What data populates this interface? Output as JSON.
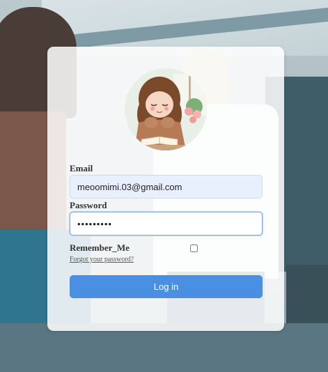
{
  "form": {
    "email_label": "Email",
    "email_value": "meoomimi.03@gmail.com",
    "password_label": "Password",
    "password_value": "•••••••••",
    "remember_label": "Remember_Me",
    "remember_checked": false,
    "forgot_link": "Forgot your password?",
    "login_button": "Log in"
  },
  "colors": {
    "button": "#4a90e2",
    "email_fill": "#e8f0fe",
    "focus_border": "#8ab0e6"
  }
}
